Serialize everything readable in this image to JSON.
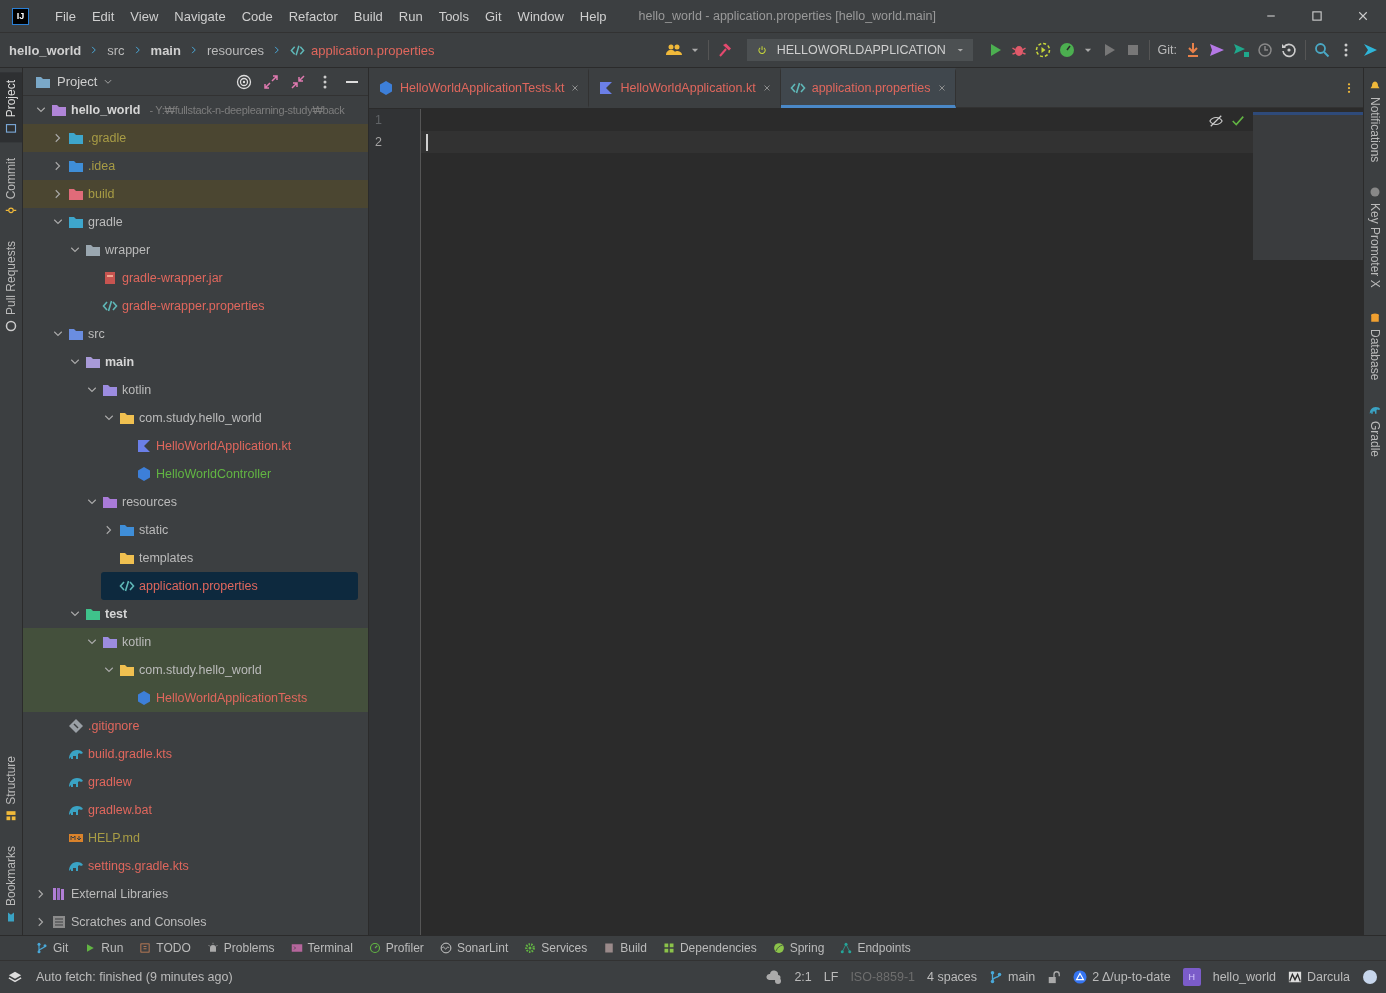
{
  "window": {
    "logo": "IJ",
    "title": "hello_world - application.properties [hello_world.main]"
  },
  "menu": [
    "File",
    "Edit",
    "View",
    "Navigate",
    "Code",
    "Refactor",
    "Build",
    "Run",
    "Tools",
    "Git",
    "Window",
    "Help"
  ],
  "breadcrumbs": [
    {
      "label": "hello_world",
      "kind": "module"
    },
    {
      "label": "src",
      "kind": "folder"
    },
    {
      "label": "main",
      "kind": "module"
    },
    {
      "label": "resources",
      "kind": "folder"
    },
    {
      "label": "application.properties",
      "kind": "file"
    }
  ],
  "toolbar": {
    "run_config": "HELLOWORLDAPPLICATION",
    "git_label": "Git:"
  },
  "left_tool_windows": {
    "top": [
      {
        "label": "Project",
        "selected": true
      },
      {
        "label": "Commit",
        "selected": false
      },
      {
        "label": "Pull Requests",
        "selected": false
      }
    ],
    "bottom": [
      {
        "label": "Structure",
        "selected": false
      },
      {
        "label": "Bookmarks",
        "selected": false
      }
    ]
  },
  "right_tool_windows": [
    {
      "label": "Notifications",
      "selected": false
    },
    {
      "label": "Key Promoter X",
      "selected": false
    },
    {
      "label": "Database",
      "selected": false
    },
    {
      "label": "Gradle",
      "selected": false
    }
  ],
  "project_panel": {
    "title": "Project",
    "tree": [
      {
        "label": "hello_world",
        "kind": "module",
        "path": "- Y:₩fullstack-n-deeplearning-study₩back",
        "expanded": true,
        "selected": false,
        "children": [
          {
            "label": ".gradle",
            "kind": "gradle-folder",
            "color": "#a89c45",
            "excluded": true,
            "expanded": false,
            "selected": false
          },
          {
            "label": ".idea",
            "kind": "idea-folder",
            "color": "#a89c45",
            "expanded": false,
            "selected": false
          },
          {
            "label": "build",
            "kind": "excluded-folder",
            "color": "#a89c45",
            "excluded": true,
            "expanded": false,
            "selected": false
          },
          {
            "label": "gradle",
            "kind": "gradle-folder",
            "expanded": true,
            "selected": false,
            "children": [
              {
                "label": "wrapper",
                "kind": "folder",
                "expanded": true,
                "selected": false,
                "children": [
                  {
                    "label": "gradle-wrapper.jar",
                    "kind": "jar",
                    "color": "#e0675d",
                    "selected": false
                  },
                  {
                    "label": "gradle-wrapper.properties",
                    "kind": "properties",
                    "color": "#e0675d",
                    "selected": false
                  }
                ]
              }
            ]
          },
          {
            "label": "src",
            "kind": "source-folder",
            "expanded": true,
            "selected": false,
            "children": [
              {
                "label": "main",
                "kind": "source-set",
                "strong": true,
                "expanded": true,
                "selected": false,
                "children": [
                  {
                    "label": "kotlin",
                    "kind": "kotlin-root",
                    "expanded": true,
                    "selected": false,
                    "children": [
                      {
                        "label": "com.study.hello_world",
                        "kind": "package",
                        "expanded": true,
                        "selected": false,
                        "children": [
                          {
                            "label": "HelloWorldApplication.kt",
                            "kind": "kotlin-file",
                            "color": "#e0675d",
                            "selected": false
                          },
                          {
                            "label": "HelloWorldController",
                            "kind": "class",
                            "color": "#62b543",
                            "selected": false
                          }
                        ]
                      }
                    ]
                  },
                  {
                    "label": "resources",
                    "kind": "resource-root",
                    "expanded": true,
                    "selected": false,
                    "children": [
                      {
                        "label": "static",
                        "kind": "static-folder",
                        "expanded": false,
                        "selected": false
                      },
                      {
                        "label": "templates",
                        "kind": "package",
                        "selected": false
                      },
                      {
                        "label": "application.properties",
                        "kind": "properties",
                        "color": "#e0675d",
                        "selected": true
                      }
                    ]
                  }
                ]
              },
              {
                "label": "test",
                "kind": "test-set",
                "strong": true,
                "expanded": true,
                "selected": false,
                "children": [
                  {
                    "label": "kotlin",
                    "kind": "kotlin-root",
                    "test_source": true,
                    "expanded": true,
                    "selected": false,
                    "children": [
                      {
                        "label": "com.study.hello_world",
                        "kind": "package",
                        "test_source": true,
                        "expanded": true,
                        "selected": false,
                        "children": [
                          {
                            "label": "HelloWorldApplicationTests",
                            "kind": "class",
                            "color": "#e0675d",
                            "test_source": true,
                            "selected": false
                          }
                        ]
                      }
                    ]
                  }
                ]
              }
            ]
          },
          {
            "label": ".gitignore",
            "kind": "gitignore",
            "color": "#e0675d",
            "selected": false
          },
          {
            "label": "build.gradle.kts",
            "kind": "gradle-script",
            "color": "#e0675d",
            "selected": false
          },
          {
            "label": "gradlew",
            "kind": "gradle-script",
            "color": "#e0675d",
            "selected": false
          },
          {
            "label": "gradlew.bat",
            "kind": "gradle-script",
            "color": "#e0675d",
            "selected": false
          },
          {
            "label": "HELP.md",
            "kind": "markdown",
            "color": "#a89c45",
            "selected": false
          },
          {
            "label": "settings.gradle.kts",
            "kind": "gradle-script",
            "color": "#e0675d",
            "selected": false
          }
        ]
      },
      {
        "label": "External Libraries",
        "kind": "libraries",
        "expanded": false,
        "selected": false
      },
      {
        "label": "Scratches and Consoles",
        "kind": "scratches",
        "expanded": false,
        "selected": false
      }
    ]
  },
  "editor": {
    "tabs": [
      {
        "label": "HelloWorldApplicationTests.kt",
        "kind": "class",
        "color": "#e0675d",
        "selected": false
      },
      {
        "label": "HelloWorldApplication.kt",
        "kind": "kotlin-file",
        "color": "#e0675d",
        "selected": false
      },
      {
        "label": "application.properties",
        "kind": "properties",
        "color": "#e0675d",
        "selected": true
      }
    ],
    "lines": [
      {
        "number": "1",
        "current": false
      },
      {
        "number": "2",
        "current": true
      }
    ]
  },
  "bottom_tools": [
    "Git",
    "Run",
    "TODO",
    "Problems",
    "Terminal",
    "Profiler",
    "SonarLint",
    "Services",
    "Build",
    "Dependencies",
    "Spring",
    "Endpoints"
  ],
  "status_bar": {
    "message": "Auto fetch: finished (9 minutes ago)",
    "position": "2:1",
    "line_separator": "LF",
    "encoding": {
      "label": "ISO-8859-1",
      "disabled": true
    },
    "indent": "4 spaces",
    "branch": "main",
    "vcs_status": "2 Δ/up-to-date",
    "project": {
      "initial": "H",
      "name": "hello_world"
    },
    "theme": "Darcula"
  }
}
